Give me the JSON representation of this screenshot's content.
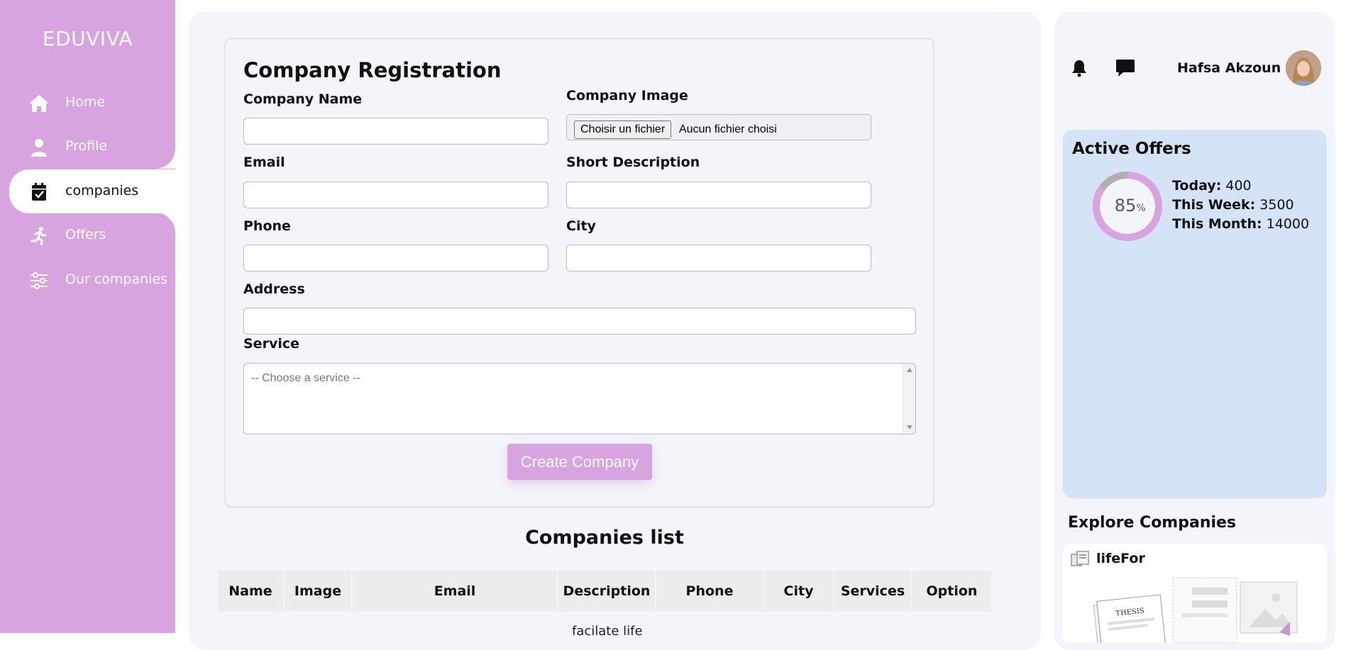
{
  "app": {
    "logo": "EDUVIVA",
    "accent": "#d8a4df"
  },
  "sidebar": {
    "items": [
      {
        "label": "Home",
        "icon": "home-icon"
      },
      {
        "label": "Profile",
        "icon": "user-icon"
      },
      {
        "label": "companies",
        "icon": "calendar-check-icon",
        "active": true
      },
      {
        "label": "Offers",
        "icon": "running-icon"
      },
      {
        "label": "Our companies",
        "icon": "sliders-icon"
      }
    ]
  },
  "form": {
    "title": "Company Registration",
    "company_name_label": "Company Name",
    "company_name_value": "",
    "company_image_label": "Company Image",
    "file_button": "Choisir un fichier",
    "file_status": "Aucun fichier choisi",
    "email_label": "Email",
    "email_value": "",
    "short_desc_label": "Short Description",
    "short_desc_value": "",
    "phone_label": "Phone",
    "phone_value": "",
    "city_label": "City",
    "city_value": "",
    "address_label": "Address",
    "address_value": "",
    "service_label": "Service",
    "service_placeholder": "-- Choose a service --",
    "submit_label": "Create Company"
  },
  "companies_list": {
    "title": "Companies list",
    "columns": [
      "Name",
      "Image",
      "Email",
      "Description",
      "Phone",
      "City",
      "Services",
      "Option"
    ],
    "first_row_description_partial": "facilate life"
  },
  "header": {
    "user_name": "Hafsa Akzoun",
    "icons": [
      "bell-icon",
      "chat-icon"
    ]
  },
  "active_offers": {
    "title": "Active Offers",
    "percent": "85",
    "percent_unit": "%",
    "today_label": "Today:",
    "today_value": "400",
    "week_label": "This Week:",
    "week_value": "3500",
    "month_label": "This Month:",
    "month_value": "14000",
    "donut_color": "#d8a4df",
    "donut_rest_color": "#b0b0b0"
  },
  "explore": {
    "title": "Explore Companies",
    "companies": [
      {
        "name": "lifeFor",
        "image_text": "THESIS"
      }
    ]
  }
}
